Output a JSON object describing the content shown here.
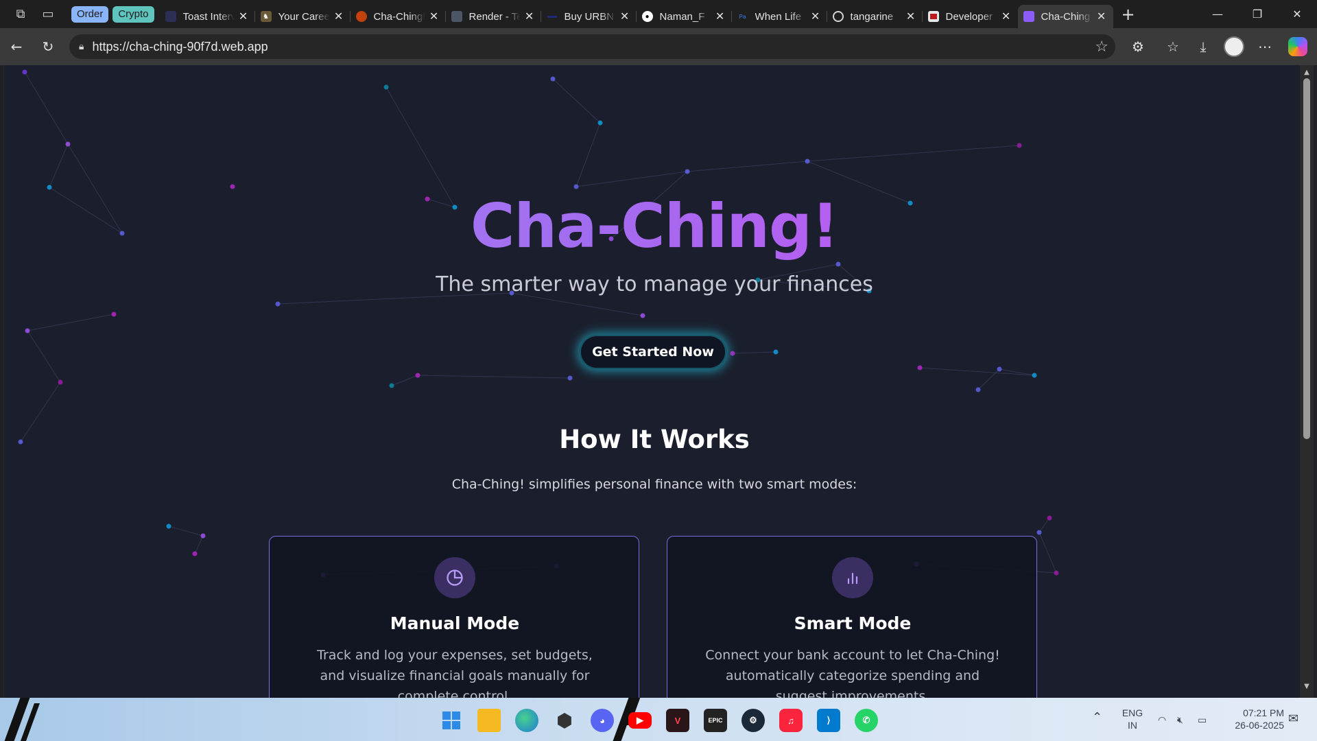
{
  "browser": {
    "tab_groups": [
      {
        "label": "Order",
        "color": "#8ab4f8"
      },
      {
        "label": "Crypto",
        "color": "#5fc4bd"
      }
    ],
    "tabs": [
      {
        "title": "Toast Interview",
        "favicon": "grid-icon",
        "color": "#2b2f55"
      },
      {
        "title": "Your Career",
        "favicon": "deer-icon",
        "color": "#6b5a3a"
      },
      {
        "title": "Cha-Ching!",
        "favicon": "flame-icon",
        "color": "#c2410c"
      },
      {
        "title": "Render - Te",
        "favicon": "render-icon",
        "color": "#4b5563"
      },
      {
        "title": "Buy URBN",
        "favicon": "dash-icon",
        "color": "#1e2a78"
      },
      {
        "title": "Naman_F",
        "favicon": "github-icon",
        "color": "#ffffff"
      },
      {
        "title": "When Life",
        "favicon": "text-icon",
        "color": "#1d4ed8"
      },
      {
        "title": "tangarine",
        "favicon": "openai-icon",
        "color": "#d4d4d4"
      },
      {
        "title": "Developer",
        "favicon": "terminal-icon",
        "color": "#b91c1c"
      },
      {
        "title": "Cha-Ching",
        "favicon": "app-icon",
        "color": "#8b5cf6",
        "active": true
      }
    ],
    "url": "https://cha-ching-90f7d.web.app"
  },
  "page": {
    "hero_title": "Cha-Ching!",
    "hero_subtitle": "The smarter way to manage your finances",
    "cta_label": "Get Started Now",
    "how_title": "How It Works",
    "how_subtitle": "Cha-Ching! simplifies personal finance with two smart modes:",
    "cards": [
      {
        "icon": "pie-chart-icon",
        "title": "Manual Mode",
        "body": "Track and log your expenses, set budgets, and visualize financial goals manually for complete control."
      },
      {
        "icon": "bar-chart-icon",
        "title": "Smart Mode",
        "body": "Connect your bank account to let Cha-Ching! automatically categorize spending and suggest improvements."
      }
    ],
    "colors": {
      "background": "#1b1f2d",
      "accent_purple": "#a78bfa",
      "accent_magenta": "#d946ef",
      "cta_glow": "#22d3ee",
      "card_border": "#7a6ee0"
    }
  },
  "taskbar": {
    "apps": [
      "windows-start-icon",
      "file-explorer-icon",
      "edge-icon",
      "unity-icon",
      "discord-icon",
      "youtube-icon",
      "valorant-icon",
      "epic-games-icon",
      "steam-icon",
      "apple-music-icon",
      "vscode-icon",
      "whatsapp-icon"
    ],
    "lang_primary": "ENG",
    "lang_secondary": "IN",
    "time": "07:21 PM",
    "date": "26-06-2025"
  }
}
